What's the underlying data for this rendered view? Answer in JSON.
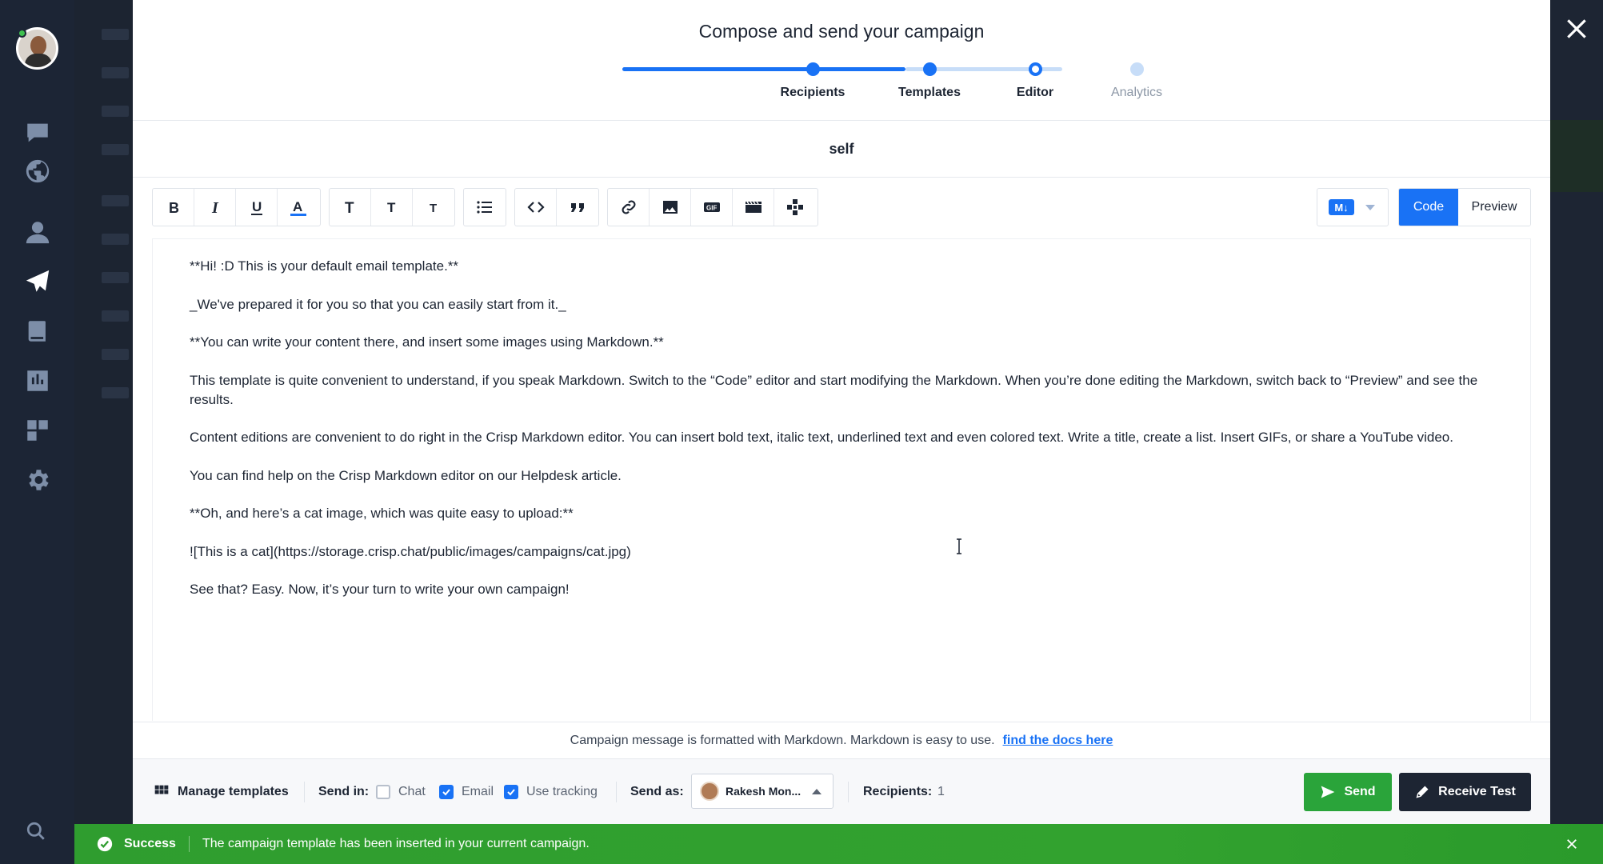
{
  "modal": {
    "title": "Compose and send your campaign",
    "subject": "self"
  },
  "stepper": {
    "steps": [
      {
        "label": "Recipients",
        "state": "done"
      },
      {
        "label": "Templates",
        "state": "done"
      },
      {
        "label": "Editor",
        "state": "current"
      },
      {
        "label": "Analytics",
        "state": "todo"
      }
    ]
  },
  "toolbar": {
    "format_badge": "M↓",
    "code_label": "Code",
    "preview_label": "Preview",
    "active_mode": "Code"
  },
  "editor": {
    "lines": [
      "**Hi! :D This is your default email template.**",
      "_We've prepared it for you so that you can easily start from it._",
      "**You can write your content there, and insert some images using Markdown.**",
      "This template is quite convenient to understand, if you speak Markdown. Switch to the “Code” editor and start modifying the Markdown. When you’re done editing the Markdown, switch back to “Preview” and see the results.",
      "Content editions are convenient to do right in the Crisp Markdown editor. You can insert bold text, italic text, underlined text and even colored text. Write a title, create a list. Insert GIFs, or share a YouTube video.",
      "You can find help on the Crisp Markdown editor on our Helpdesk article.",
      "**Oh, and here’s a cat image, which was quite easy to upload:**",
      "![This is a cat](https://storage.crisp.chat/public/images/campaigns/cat.jpg)",
      "See that? Easy. Now, it’s your turn to write your own campaign!"
    ]
  },
  "hint": {
    "text": "Campaign message is formatted with Markdown. Markdown is easy to use.",
    "link": "find the docs here"
  },
  "actionbar": {
    "manage_templates": "Manage templates",
    "send_in_label": "Send in:",
    "chat_label": "Chat",
    "chat_checked": false,
    "email_label": "Email",
    "email_checked": true,
    "tracking_label": "Use tracking",
    "tracking_checked": true,
    "send_as_label": "Send as:",
    "sender_name": "Rakesh Mon...",
    "recipients_label": "Recipients:",
    "recipients_count": "1",
    "send_button": "Send",
    "test_button": "Receive Test"
  },
  "toast": {
    "title": "Success",
    "message": "The campaign template has been inserted in your current campaign."
  },
  "colors": {
    "accent": "#1972f5",
    "success": "#2aa43a",
    "dark": "#1d2533",
    "sidebar": "#1c2535"
  },
  "icons": {
    "sidebar": [
      "chat-icon",
      "globe-icon",
      "user-icon",
      "paper-plane-icon",
      "book-icon",
      "chart-icon",
      "plugins-icon",
      "gear-icon",
      "search-icon"
    ]
  }
}
